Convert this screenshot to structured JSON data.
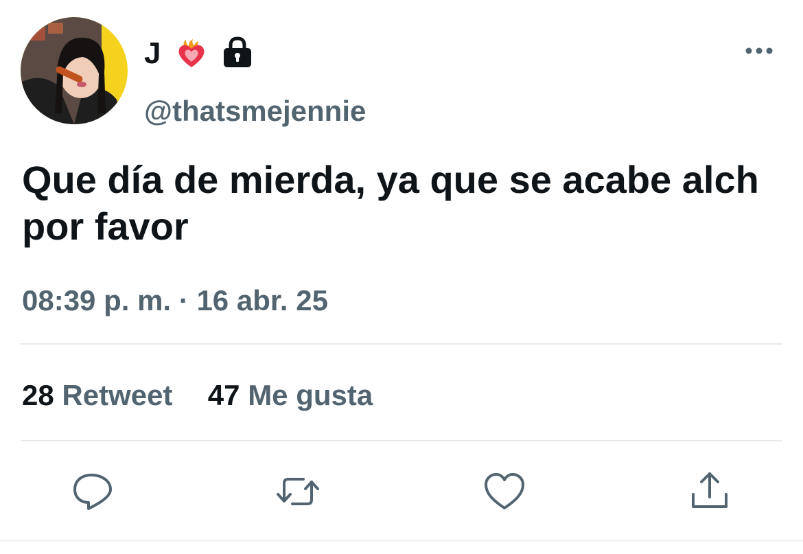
{
  "user": {
    "name": "J",
    "handle": "@thatsmejennie"
  },
  "tweet": {
    "text": "Que día de mierda, ya que se acabe alch por favor",
    "time": "08:39 p. m.",
    "separator": "·",
    "date": "16 abr. 25"
  },
  "stats": {
    "retweets_count": "28",
    "retweets_label": "Retweet",
    "likes_count": "47",
    "likes_label": "Me gusta"
  },
  "icons": {
    "badge": "heart-on-fire-icon",
    "lock": "lock-icon",
    "more": "more-icon",
    "reply": "reply-icon",
    "retweet": "retweet-icon",
    "like": "like-icon",
    "share": "share-icon"
  },
  "colors": {
    "text_primary": "#0f1419",
    "text_secondary": "#536471",
    "divider": "#e6e9ec",
    "icon": "#536471"
  }
}
